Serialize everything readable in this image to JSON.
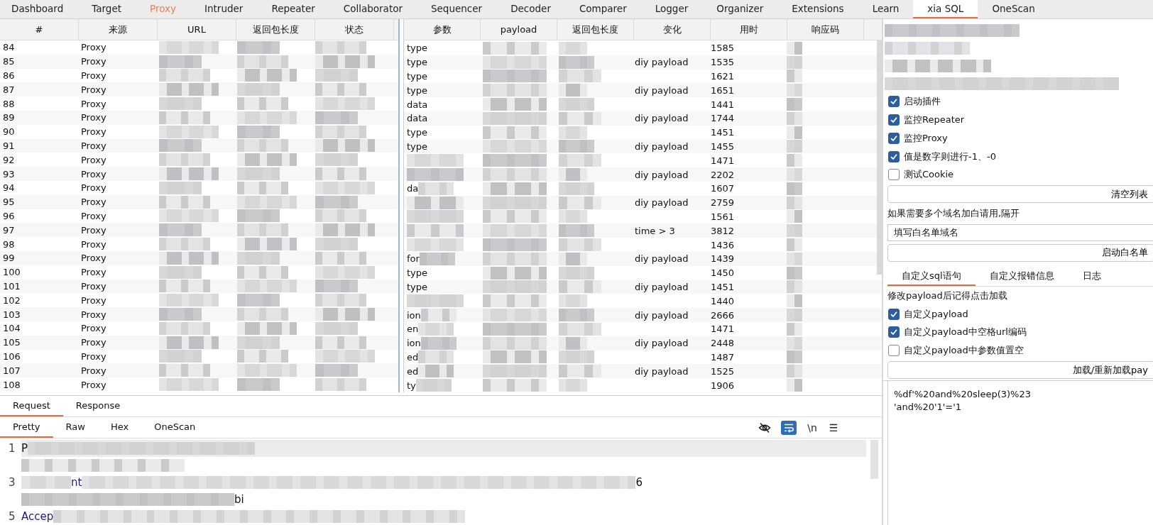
{
  "tabs": [
    {
      "label": "Dashboard",
      "selected": false,
      "highlighted": false
    },
    {
      "label": "Target",
      "selected": false,
      "highlighted": false
    },
    {
      "label": "Proxy",
      "selected": false,
      "highlighted": true
    },
    {
      "label": "Intruder",
      "selected": false,
      "highlighted": false
    },
    {
      "label": "Repeater",
      "selected": false,
      "highlighted": false
    },
    {
      "label": "Collaborator",
      "selected": false,
      "highlighted": false
    },
    {
      "label": "Sequencer",
      "selected": false,
      "highlighted": false
    },
    {
      "label": "Decoder",
      "selected": false,
      "highlighted": false
    },
    {
      "label": "Comparer",
      "selected": false,
      "highlighted": false
    },
    {
      "label": "Logger",
      "selected": false,
      "highlighted": false
    },
    {
      "label": "Organizer",
      "selected": false,
      "highlighted": false
    },
    {
      "label": "Extensions",
      "selected": false,
      "highlighted": false
    },
    {
      "label": "Learn",
      "selected": false,
      "highlighted": false
    },
    {
      "label": "xia SQL",
      "selected": true,
      "highlighted": false
    },
    {
      "label": "OneScan",
      "selected": false,
      "highlighted": false
    }
  ],
  "history_table": {
    "columns": [
      {
        "label": "#"
      },
      {
        "label": "来源"
      },
      {
        "label": "URL"
      },
      {
        "label": "返回包长度"
      },
      {
        "label": "状态"
      }
    ],
    "rows": [
      {
        "cells": [
          "84",
          "Proxy"
        ]
      },
      {
        "cells": [
          "85",
          "Proxy"
        ]
      },
      {
        "cells": [
          "86",
          "Proxy"
        ]
      },
      {
        "cells": [
          "87",
          "Proxy"
        ]
      },
      {
        "cells": [
          "88",
          "Proxy"
        ]
      },
      {
        "cells": [
          "89",
          "Proxy"
        ]
      },
      {
        "cells": [
          "90",
          "Proxy"
        ]
      },
      {
        "cells": [
          "91",
          "Proxy"
        ]
      },
      {
        "cells": [
          "92",
          "Proxy"
        ]
      },
      {
        "cells": [
          "93",
          "Proxy"
        ]
      },
      {
        "cells": [
          "94",
          "Proxy"
        ]
      },
      {
        "cells": [
          "95",
          "Proxy"
        ]
      },
      {
        "cells": [
          "96",
          "Proxy"
        ]
      },
      {
        "cells": [
          "97",
          "Proxy"
        ]
      },
      {
        "cells": [
          "98",
          "Proxy"
        ]
      },
      {
        "cells": [
          "99",
          "Proxy"
        ]
      },
      {
        "cells": [
          "100",
          "Proxy"
        ]
      },
      {
        "cells": [
          "101",
          "Proxy"
        ]
      },
      {
        "cells": [
          "102",
          "Proxy"
        ]
      },
      {
        "cells": [
          "103",
          "Proxy"
        ]
      },
      {
        "cells": [
          "104",
          "Proxy"
        ]
      },
      {
        "cells": [
          "105",
          "Proxy"
        ]
      },
      {
        "cells": [
          "106",
          "Proxy"
        ]
      },
      {
        "cells": [
          "107",
          "Proxy"
        ]
      },
      {
        "cells": [
          "108",
          "Proxy"
        ]
      }
    ]
  },
  "payload_table": {
    "columns": [
      {
        "label": "参数"
      },
      {
        "label": "payload"
      },
      {
        "label": "返回包长度"
      },
      {
        "label": "变化"
      },
      {
        "label": "用时"
      },
      {
        "label": "响应码"
      }
    ],
    "rows": [
      {
        "param": "type",
        "time": "1585"
      },
      {
        "param": "type",
        "change": "diy payload",
        "time": "1535"
      },
      {
        "param": "type",
        "time": "1621"
      },
      {
        "param": "type",
        "change": "diy payload",
        "time": "1651"
      },
      {
        "param": "data",
        "time": "1441"
      },
      {
        "param": "data",
        "change": "diy payload",
        "time": "1744"
      },
      {
        "param": "type",
        "time": "1451"
      },
      {
        "param": "type",
        "change": "diy payload",
        "time": "1455"
      },
      {
        "time": "1471"
      },
      {
        "change": "diy payload",
        "time": "2202"
      },
      {
        "param": "da",
        "time": "1607"
      },
      {
        "change": "diy payload",
        "time": "2759"
      },
      {
        "time": "1561"
      },
      {
        "change": "time > 3",
        "time": "3812"
      },
      {
        "time": "1436"
      },
      {
        "param": "for",
        "change": "diy payload",
        "time": "1439"
      },
      {
        "param": "type",
        "time": "1450"
      },
      {
        "param": "type",
        "change": "diy payload",
        "time": "1451"
      },
      {
        "time": "1440"
      },
      {
        "param": "ion",
        "change": "diy payload",
        "time": "2666"
      },
      {
        "param": "en",
        "time": "1471"
      },
      {
        "param": "ion",
        "change": "diy payload",
        "time": "2448"
      },
      {
        "param": "ed",
        "time": "1487"
      },
      {
        "param": "ed",
        "change": "diy payload",
        "time": "1525"
      },
      {
        "param": "ty",
        "time": "1906"
      }
    ]
  },
  "message_tabs": [
    {
      "label": "Request",
      "selected": true
    },
    {
      "label": "Response",
      "selected": false
    }
  ],
  "view_tabs": [
    {
      "label": "Pretty",
      "selected": true
    },
    {
      "label": "Raw",
      "selected": false
    },
    {
      "label": "Hex",
      "selected": false
    },
    {
      "label": "OneScan",
      "selected": false
    }
  ],
  "toolbar": [
    {
      "kind": "hide",
      "active": false
    },
    {
      "kind": "wrap",
      "active": true
    },
    {
      "kind": "text",
      "label": "\\n",
      "active": false
    },
    {
      "kind": "menu",
      "label": "☰",
      "active": false
    }
  ],
  "editor": {
    "lines": [
      {
        "number": "1",
        "current": true,
        "fragments": [
          {
            "text": "P",
            "kind": "plain"
          }
        ]
      },
      {
        "current": false
      },
      {
        "number": "3",
        "current": false,
        "fragments": [
          {
            "text": "nt",
            "kind": "header"
          },
          {
            "text": "6",
            "kind": "plain"
          }
        ]
      },
      {
        "current": false,
        "fragments": [
          {
            "text": "bi",
            "kind": "plain"
          }
        ]
      },
      {
        "number": "5",
        "current": false,
        "fragments": [
          {
            "text": "Accep",
            "kind": "header"
          }
        ]
      }
    ]
  },
  "xia_sql": {
    "info_lines": [
      {
        "redacted": true
      },
      {
        "redacted": true
      },
      {
        "redacted": true
      },
      {
        "redacted": true
      }
    ],
    "options": [
      {
        "label": "启动插件",
        "checked": true
      },
      {
        "label": "监控Repeater",
        "checked": true
      },
      {
        "label": "监控Proxy",
        "checked": true
      },
      {
        "label": "值是数字则进行-1、-0",
        "checked": true
      },
      {
        "label": "测试Cookie",
        "checked": false
      }
    ],
    "clear_button": "清空列表",
    "whitelist_label": "如果需要多个域名加白请用,隔开",
    "whitelist_field": {
      "value": "填写白名单域名"
    },
    "whitelist_button": "启动白名单",
    "tabs": [
      {
        "label": "自定义sql语句",
        "selected": true
      },
      {
        "label": "自定义报错信息",
        "selected": false
      },
      {
        "label": "日志",
        "selected": false
      }
    ],
    "payload_hint": "修改payload后记得点击加载",
    "payload_options": [
      {
        "label": "自定义payload",
        "checked": true
      },
      {
        "label": "自定义payload中空格url编码",
        "checked": true
      },
      {
        "label": "自定义payload中参数值置空",
        "checked": false
      }
    ],
    "load_button": "加载/重新加载pay",
    "payload_lines": [
      "%df'%20and%20sleep(3)%23",
      "'and%20'1'='1"
    ]
  }
}
